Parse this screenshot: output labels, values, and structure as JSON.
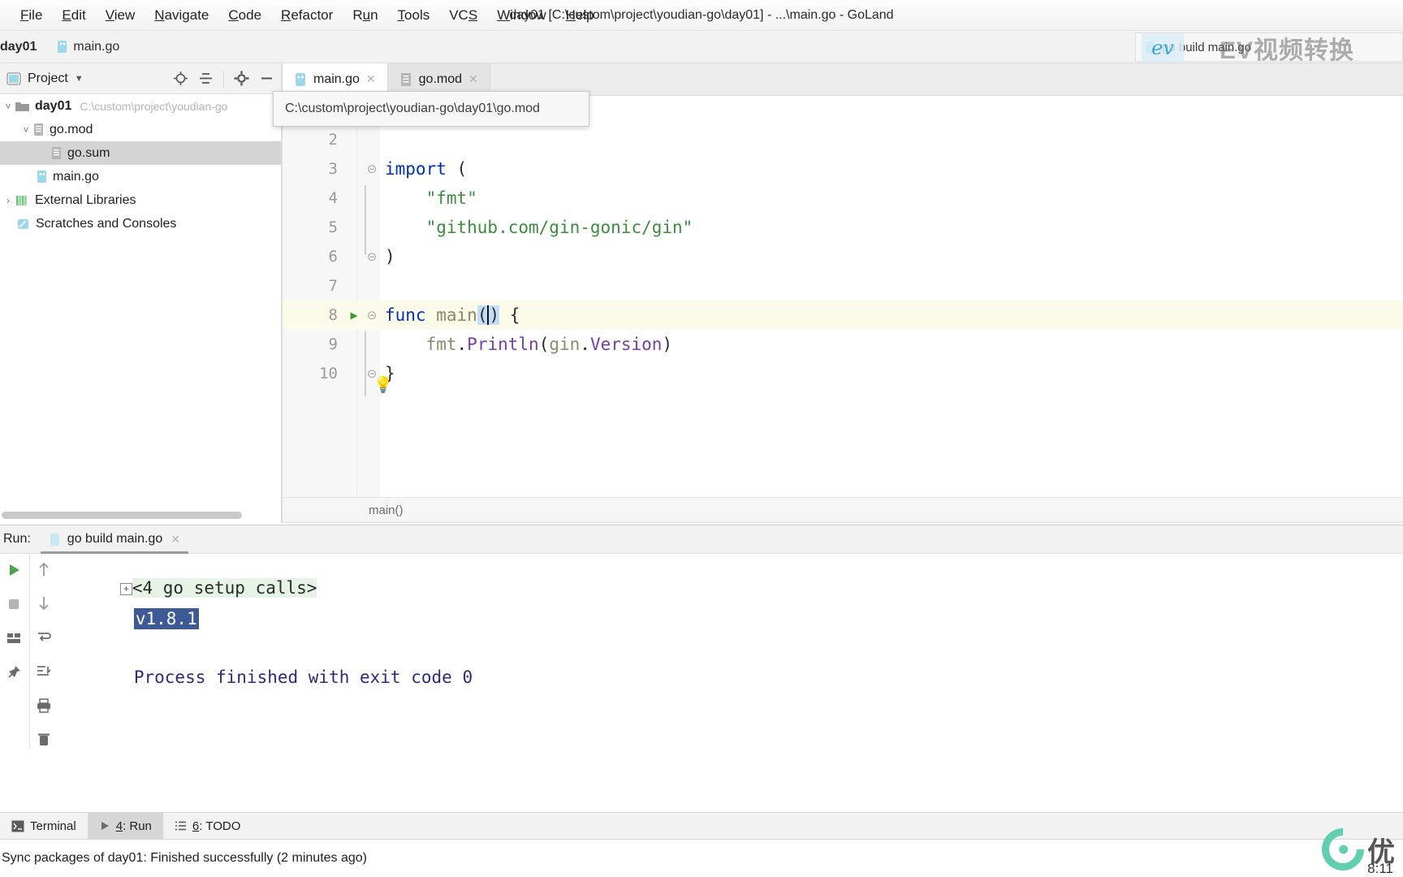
{
  "window": {
    "title": "day01 [C:\\custom\\project\\youdian-go\\day01] - ...\\main.go - GoLand"
  },
  "menubar": {
    "items": [
      {
        "label": "File",
        "mnemonic": "F"
      },
      {
        "label": "Edit",
        "mnemonic": "E"
      },
      {
        "label": "View",
        "mnemonic": "V"
      },
      {
        "label": "Navigate",
        "mnemonic": "N"
      },
      {
        "label": "Code",
        "mnemonic": "C"
      },
      {
        "label": "Refactor",
        "mnemonic": "R"
      },
      {
        "label": "Run",
        "mnemonic": "u"
      },
      {
        "label": "Tools",
        "mnemonic": "T"
      },
      {
        "label": "VCS",
        "mnemonic": "S"
      },
      {
        "label": "Window",
        "mnemonic": "W"
      },
      {
        "label": "Help",
        "mnemonic": "H"
      }
    ]
  },
  "navbar": {
    "project_crumb": "day01",
    "file_crumb": "main.go"
  },
  "run_widget": {
    "configuration": "go build main.go"
  },
  "project_panel": {
    "title": "Project",
    "tree": [
      {
        "label": "day01",
        "path": "C:\\custom\\project\\youdian-go",
        "bold": true,
        "twisty": "v",
        "indent": 0,
        "icon": "folder",
        "selected": false
      },
      {
        "label": "go.mod",
        "path": "",
        "bold": false,
        "twisty": "v",
        "indent": 1,
        "icon": "gomod-file",
        "selected": false
      },
      {
        "label": "go.sum",
        "path": "",
        "bold": false,
        "twisty": "",
        "indent": 2,
        "icon": "gosum-file",
        "selected": true
      },
      {
        "label": "main.go",
        "path": "",
        "bold": false,
        "twisty": "",
        "indent": 2,
        "icon": "go-file",
        "selected": false
      },
      {
        "label": "External Libraries",
        "path": "",
        "bold": false,
        "twisty": ">",
        "indent": 0,
        "icon": "library",
        "selected": false
      },
      {
        "label": "Scratches and Consoles",
        "path": "",
        "bold": false,
        "twisty": "",
        "indent": 0,
        "icon": "scratches",
        "selected": false
      }
    ]
  },
  "editor": {
    "tabs": [
      {
        "label": "main.go",
        "icon": "go-file",
        "active": true
      },
      {
        "label": "go.mod",
        "icon": "gomod-file",
        "active": false
      }
    ],
    "tooltip": "C:\\custom\\project\\youdian-go\\day01\\go.mod",
    "breadcrumb": "main()",
    "lines": [
      {
        "number": "2",
        "text": ""
      },
      {
        "number": "3",
        "text": "import ("
      },
      {
        "number": "4",
        "text": "    \"fmt\""
      },
      {
        "number": "5",
        "text": "    \"github.com/gin-gonic/gin\""
      },
      {
        "number": "6",
        "text": ")"
      },
      {
        "number": "7",
        "text": ""
      },
      {
        "number": "8",
        "text": "func main() {"
      },
      {
        "number": "9",
        "text": "    fmt.Println(gin.Version)"
      },
      {
        "number": "10",
        "text": "}"
      }
    ],
    "tokens": {
      "kw_import": "import",
      "paren_open": "(",
      "paren_close": ")",
      "str_fmt": "\"fmt\"",
      "str_gin": "\"github.com/gin-gonic/gin\"",
      "kw_func": "func",
      "name_main": "main",
      "brace_open": "{",
      "brace_close": "}",
      "pkg_fmt": "fmt",
      "dot": ".",
      "fn_println": "Println",
      "pkg_gin": "gin",
      "fn_version": "Version"
    }
  },
  "run_panel": {
    "label": "Run:",
    "tab": "go build main.go",
    "output": {
      "setup_calls": "<4 go setup calls>",
      "version": "v1.8.1",
      "process": "Process finished with exit code 0"
    }
  },
  "toolwindow_bar": {
    "items": [
      {
        "label": "Terminal",
        "num": "",
        "icon": "terminal-icon",
        "active": false
      },
      {
        "label": "Run",
        "num": "4",
        "icon": "run-icon",
        "active": true
      },
      {
        "label": "TODO",
        "num": "6",
        "icon": "todo-icon",
        "active": false
      }
    ]
  },
  "statusbar": {
    "message": "Sync packages of day01: Finished successfully (2 minutes ago)"
  },
  "watermark": {
    "ev": "ev",
    "ev_text": "EV视频转换",
    "logo_text": "优",
    "time": "8:11"
  },
  "colors": {
    "accent": "#4a86c8",
    "keyword": "#0033b3",
    "string": "#3d8c40",
    "function": "#7a3e9d",
    "selection": "#3d5a96",
    "setup_bg": "#e6f3e6",
    "run_green": "#3a9a3a"
  }
}
